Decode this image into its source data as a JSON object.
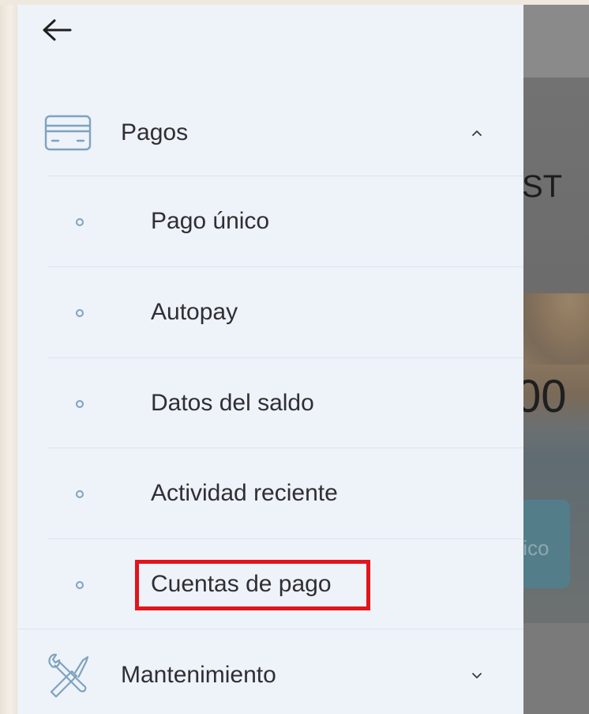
{
  "drawer": {
    "back_icon": "arrow-left-icon",
    "sections": {
      "payments": {
        "label": "Pagos",
        "icon": "credit-card-icon",
        "expanded": true,
        "items": [
          {
            "label": "Pago único"
          },
          {
            "label": "Autopay"
          },
          {
            "label": "Datos del saldo"
          },
          {
            "label": "Actividad reciente"
          },
          {
            "label": "Cuentas de pago"
          }
        ]
      },
      "maintenance": {
        "label": "Mantenimiento",
        "icon": "wrench-screwdriver-icon",
        "expanded": false
      }
    },
    "highlighted_item": "Cuentas de pago"
  },
  "background_app": {
    "partial_text_top": "ST",
    "partial_text_amount": "00",
    "partial_button_label": "tico"
  },
  "colors": {
    "drawer_bg": "#eef2f9",
    "accent_icon": "#7ea3bd",
    "text": "#2f2f33",
    "highlight": "#e3141b",
    "overlay": "#6f6f6f"
  }
}
